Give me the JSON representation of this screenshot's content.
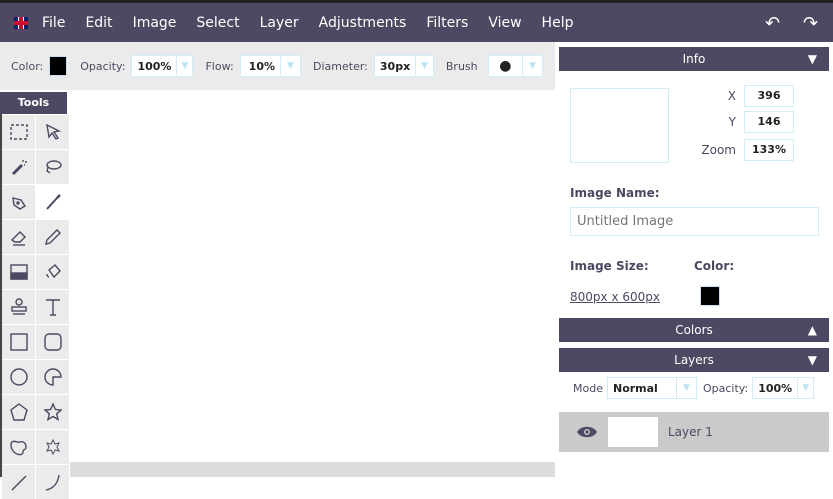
{
  "menubar": {
    "items": [
      "File",
      "Edit",
      "Image",
      "Select",
      "Layer",
      "Adjustments",
      "Filters",
      "View",
      "Help"
    ],
    "flag_icon": "uk-flag-icon",
    "undo_icon": "undo-icon",
    "redo_icon": "redo-icon"
  },
  "toolbar": {
    "color_label": "Color:",
    "color_value": "#000000",
    "opacity_label": "Opacity:",
    "opacity_value": "100%",
    "flow_label": "Flow:",
    "flow_value": "10%",
    "diameter_label": "Diameter:",
    "diameter_value": "30px",
    "brush_label": "Brush"
  },
  "tools": {
    "title": "Tools",
    "items": [
      "select",
      "pointer",
      "magic-wand",
      "lasso",
      "pen",
      "brush",
      "eraser",
      "pencil",
      "gradient",
      "fill",
      "stamp",
      "text",
      "rectangle",
      "rounded-rectangle",
      "ellipse",
      "pie",
      "pentagon",
      "star",
      "blob",
      "gear-star",
      "line",
      "curve"
    ],
    "active": "brush"
  },
  "info": {
    "title": "Info",
    "x_label": "X",
    "x_value": "396",
    "y_label": "Y",
    "y_value": "146",
    "zoom_label": "Zoom",
    "zoom_value": "133%",
    "name_label": "Image Name:",
    "name_placeholder": "Untitled Image",
    "size_label": "Image Size:",
    "size_value": "800px x 600px",
    "color_label": "Color:",
    "color_value": "#000000"
  },
  "colors": {
    "title": "Colors"
  },
  "layers": {
    "title": "Layers",
    "mode_label": "Mode",
    "mode_value": "Normal",
    "opacity_label": "Opacity:",
    "opacity_value": "100%",
    "items": [
      {
        "name": "Layer 1",
        "visible": true
      }
    ]
  },
  "theme": {
    "accent": "#4e4862",
    "border": "#d4ecf7"
  }
}
